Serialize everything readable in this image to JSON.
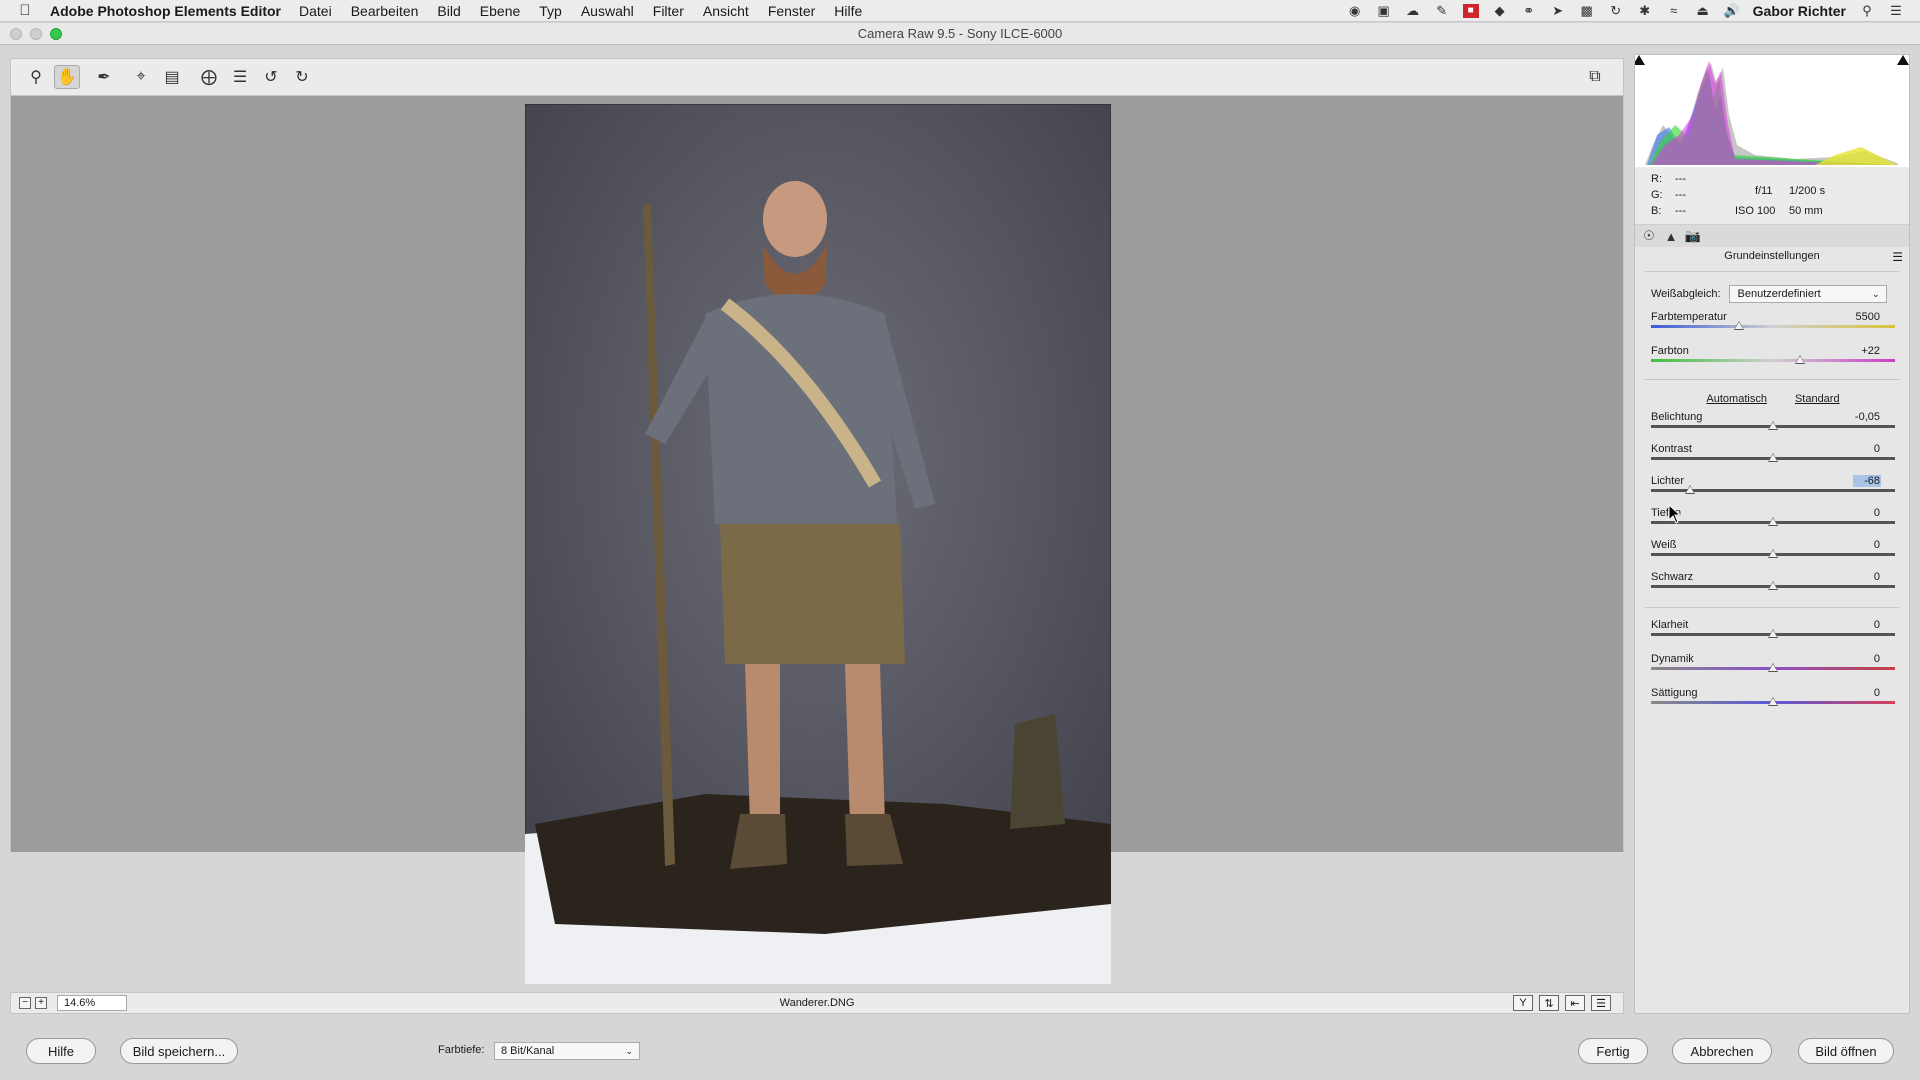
{
  "menubar": {
    "apple_icon": "apple-icon",
    "app_name": "Adobe Photoshop Elements Editor",
    "items": [
      "Datei",
      "Bearbeiten",
      "Bild",
      "Ebene",
      "Typ",
      "Auswahl",
      "Filter",
      "Ansicht",
      "Fenster",
      "Hilfe"
    ],
    "user": "Gabor Richter"
  },
  "window": {
    "title": "Camera Raw 9.5 - Sony ILCE-6000"
  },
  "status": {
    "zoom": "14.6%",
    "filename": "Wanderer.DNG"
  },
  "camera": {
    "r_label": "R:",
    "r_value": "---",
    "g_label": "G:",
    "g_value": "---",
    "b_label": "B:",
    "b_value": "---",
    "aperture": "f/11",
    "shutter": "1/200 s",
    "iso": "ISO 100",
    "focal": "50 mm"
  },
  "panel": {
    "section_title": "Grundeinstellungen",
    "wb_label": "Weißabgleich:",
    "wb_value": "Benutzerdefiniert",
    "auto_label": "Automatisch",
    "standard_label": "Standard",
    "sliders": {
      "temperature": {
        "label": "Farbtemperatur",
        "value": "5500",
        "level": 0.36
      },
      "tint": {
        "label": "Farbton",
        "value": "+22",
        "level": 0.61
      },
      "exposure": {
        "label": "Belichtung",
        "value": "-0,05",
        "level": 0.5
      },
      "contrast": {
        "label": "Kontrast",
        "value": "0",
        "level": 0.5
      },
      "highlights": {
        "label": "Lichter",
        "value": "-68",
        "level": 0.16
      },
      "shadows": {
        "label": "Tiefen",
        "value": "0",
        "level": 0.5
      },
      "whites": {
        "label": "Weiß",
        "value": "0",
        "level": 0.5
      },
      "blacks": {
        "label": "Schwarz",
        "value": "0",
        "level": 0.5
      },
      "clarity": {
        "label": "Klarheit",
        "value": "0",
        "level": 0.5
      },
      "vibrance": {
        "label": "Dynamik",
        "value": "0",
        "level": 0.5
      },
      "saturation": {
        "label": "Sättigung",
        "value": "0",
        "level": 0.5
      }
    }
  },
  "footer": {
    "help": "Hilfe",
    "save": "Bild speichern...",
    "depth_label": "Farbtiefe:",
    "depth_value": "8 Bit/Kanal",
    "done": "Fertig",
    "cancel": "Abbrechen",
    "open": "Bild öffnen"
  }
}
